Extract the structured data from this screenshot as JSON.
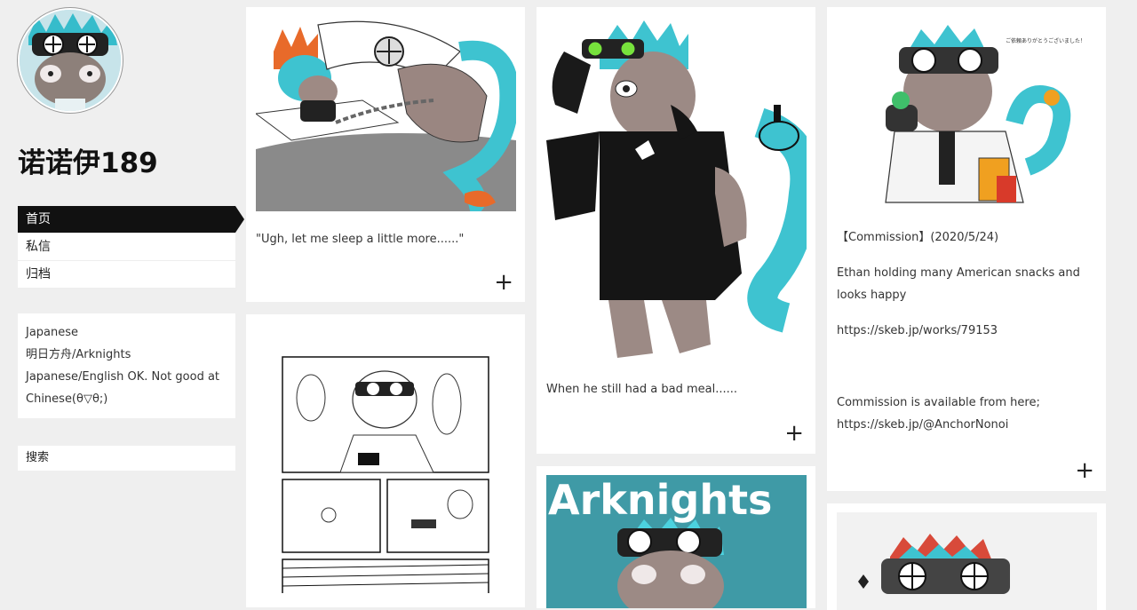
{
  "site": {
    "title": "诺诺伊189"
  },
  "nav": {
    "items": [
      {
        "label": "首页"
      },
      {
        "label": "私信"
      },
      {
        "label": "归档"
      }
    ]
  },
  "profile": {
    "lines": [
      "Japanese",
      "明日方舟/Arknights",
      "Japanese/English OK. Not good at Chinese(θ▽θ;)"
    ]
  },
  "search": {
    "label": "搜索"
  },
  "posts": [
    {
      "caption": "\"Ugh, let me sleep a little more......\"",
      "more": "+"
    },
    {
      "caption": "When he still had a bad meal......",
      "more": "+"
    },
    {
      "lines": [
        "【Commission】(2020/5/24)",
        "Ethan holding many American snacks and looks happy",
        "https://skeb.jp/works/79153",
        "Commission is available from here; https://skeb.jp/@AnchorNonoi"
      ],
      "more": "+"
    }
  ],
  "art_text": {
    "arknights_banner": "Arknights"
  },
  "colors": {
    "background": "#efefef",
    "nav_active": "#111111",
    "teal": "#3ec3d0"
  }
}
